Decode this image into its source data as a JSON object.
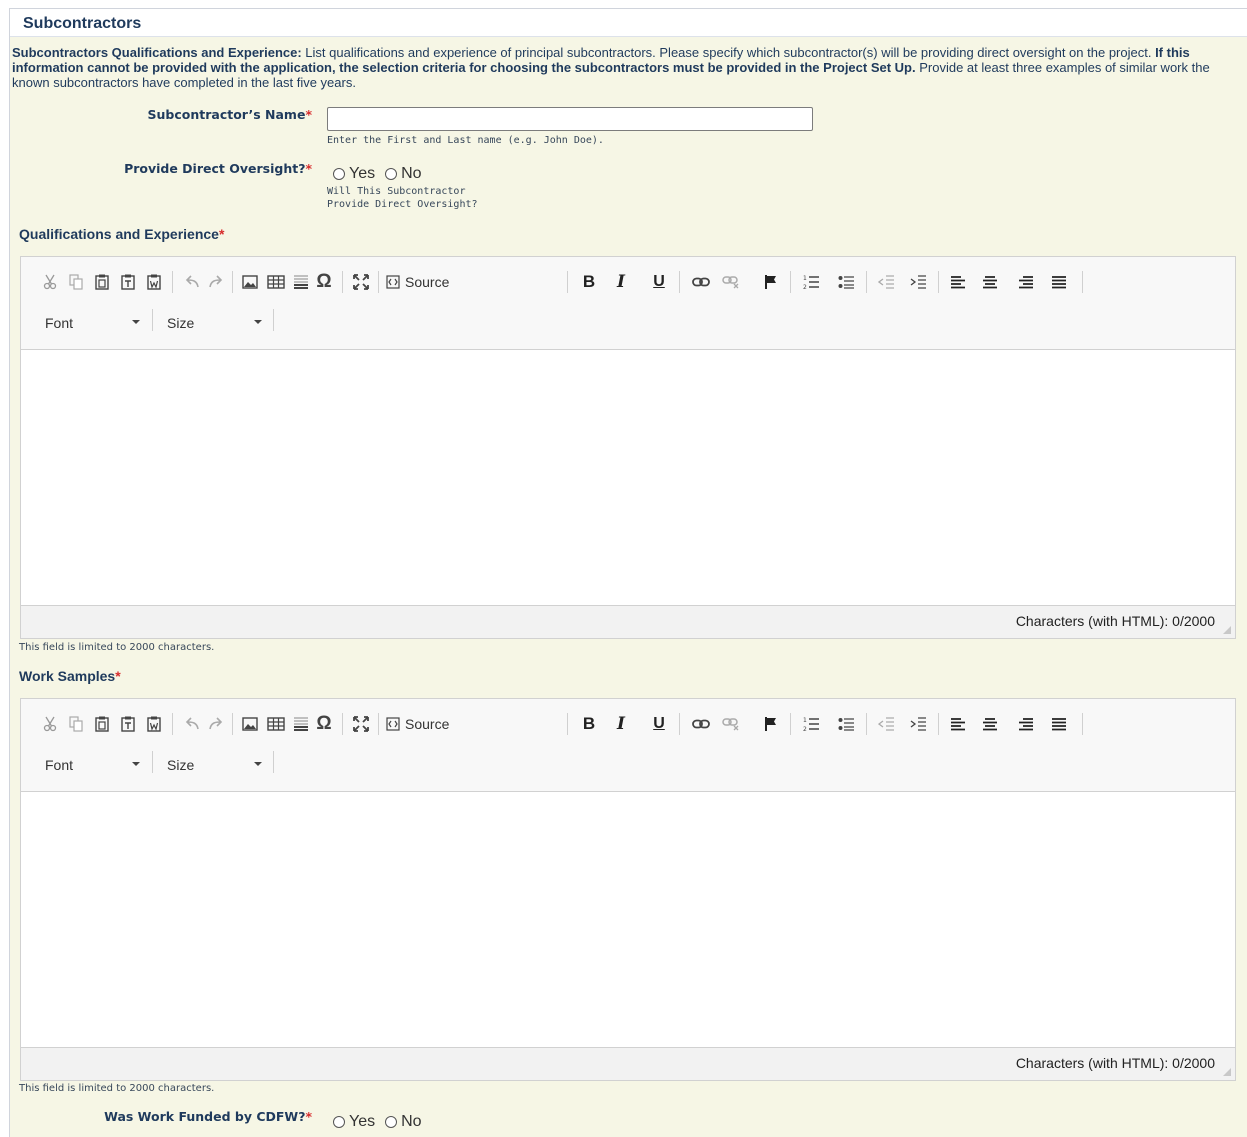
{
  "section": {
    "title": "Subcontractors"
  },
  "intro": {
    "lead_bold": "Subcontractors Qualifications and Experience:",
    "text_1": " List qualifications and experience of principal subcontractors. Please specify which subcontractor(s) will be providing direct oversight on the project. ",
    "bold_2": "If this information cannot be provided with the application, the selection criteria for choosing the subcontractors must be provided in the Project Set Up.",
    "text_3": " Provide at least three examples of similar work the known subcontractors have completed in the last five years."
  },
  "fields": {
    "name_label": "Subcontractor’s Name",
    "name_value": "",
    "name_hint": "Enter the First and Last name (e.g. John Doe).",
    "oversight_label": "Provide Direct Oversight?",
    "oversight_hint": "Will This Subcontractor\nProvide Direct Oversight?",
    "yes": "Yes",
    "no": "No",
    "funded_label": "Was Work Funded by CDFW?",
    "required_mark": "*"
  },
  "editors": [
    {
      "label": "Qualifications and Experience",
      "char_count": "Characters (with HTML): 0/2000",
      "limit_note": "This field is limited to 2000 characters."
    },
    {
      "label": "Work Samples",
      "char_count": "Characters (with HTML): 0/2000",
      "limit_note": "This field is limited to 2000 characters."
    }
  ],
  "toolbar": {
    "source_label": "Source",
    "bold": "B",
    "italic": "I",
    "underline": "U",
    "omega": "Ω",
    "font_label": "Font",
    "size_label": "Size"
  }
}
